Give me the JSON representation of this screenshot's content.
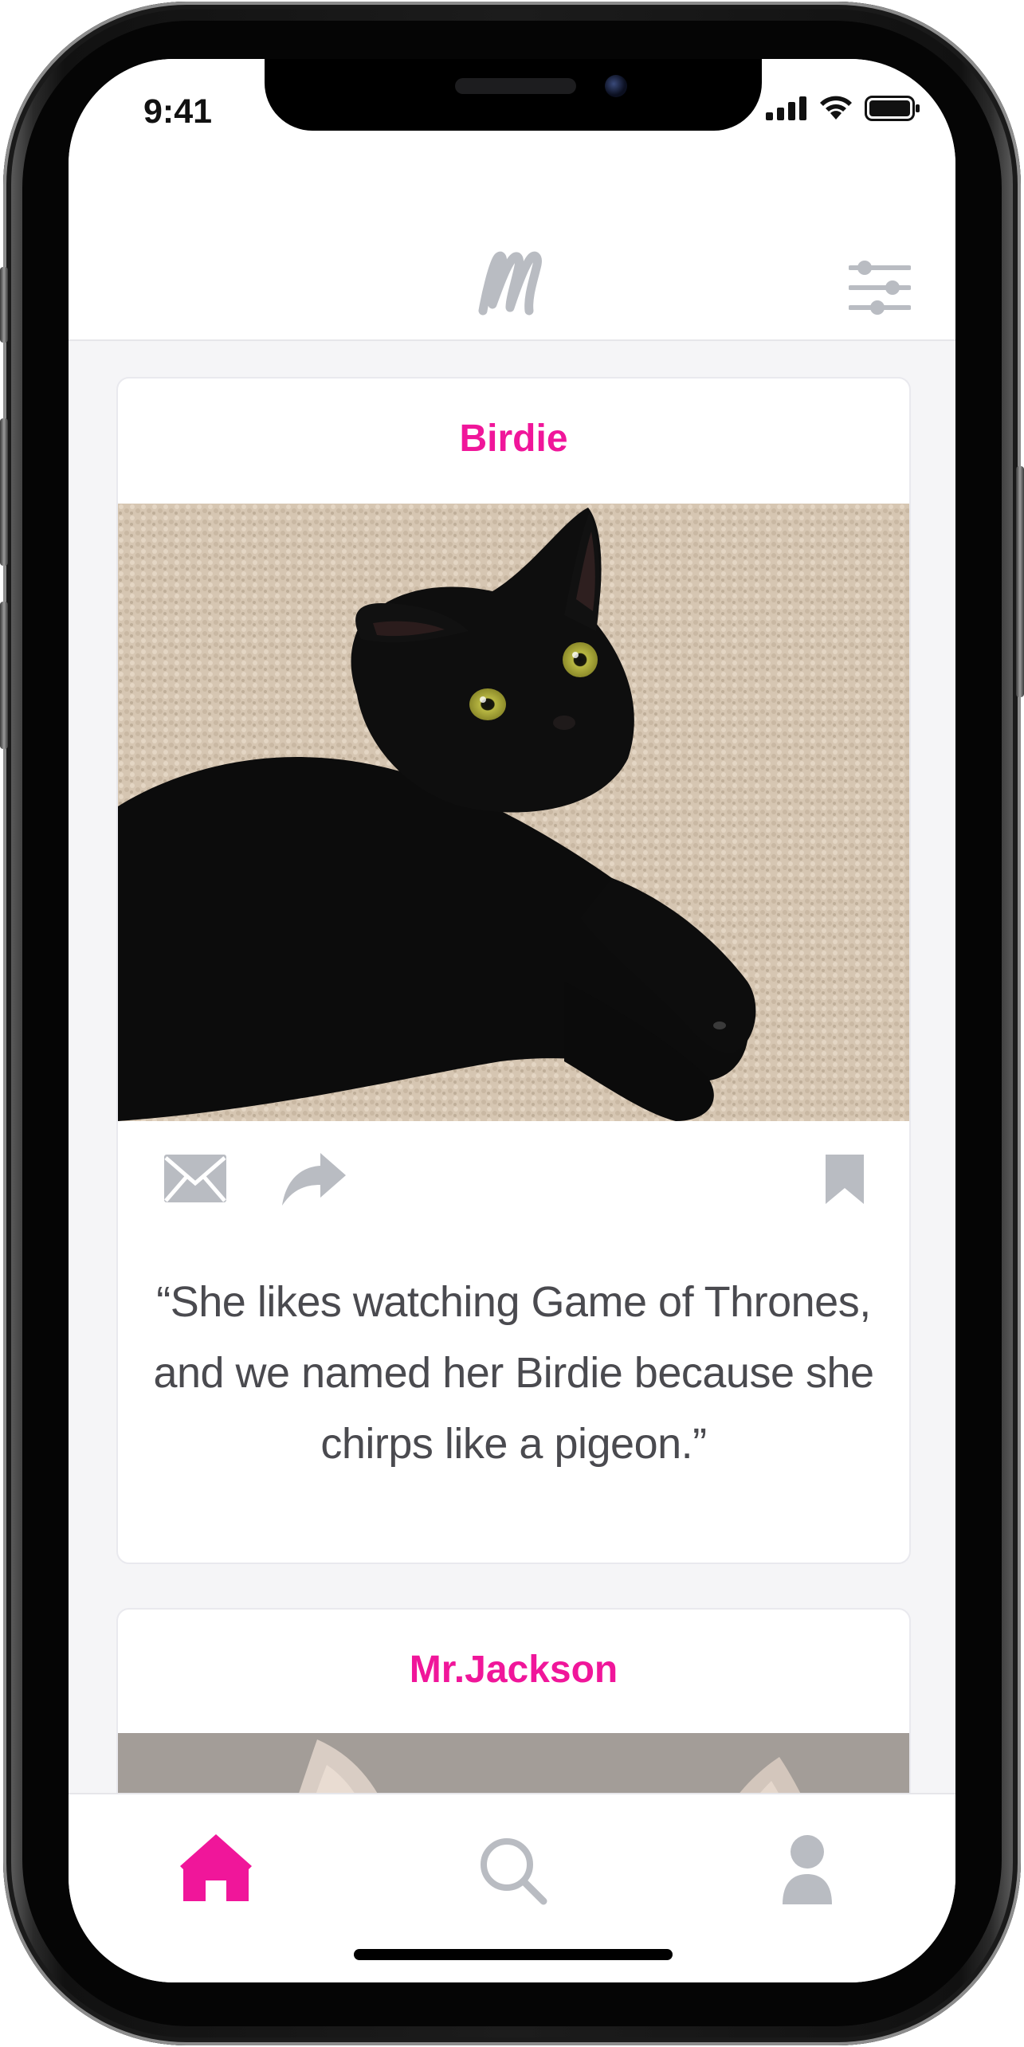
{
  "status_bar": {
    "time": "9:41"
  },
  "header": {
    "logo_icon": "m-script-logo-icon",
    "filter_icon": "sliders-icon"
  },
  "feed": {
    "cards": [
      {
        "name": "Birdie",
        "photo": "black cat lying on beige carpet looking up",
        "quote": "“She likes watching Game of Thrones, and we named her Birdie because she chirps like a pigeon.”",
        "quote_lines": [
          "“She likes watching Game of Thrones,",
          "and we named her Birdie because she",
          "chirps like a pigeon.”"
        ],
        "actions": [
          "envelope-icon",
          "share-icon",
          "bookmark-icon"
        ]
      },
      {
        "name": "Mr.Jackson",
        "photo": "tortoiseshell cat ears"
      }
    ]
  },
  "tab_bar": {
    "tabs": [
      {
        "icon": "home-icon",
        "active": true
      },
      {
        "icon": "search-icon",
        "active": false
      },
      {
        "icon": "profile-icon",
        "active": false
      }
    ]
  },
  "colors": {
    "accent": "#f0169a",
    "icon_gray": "#b9bcc2",
    "background": "#f5f5f7",
    "text": "#4a4a4f"
  }
}
